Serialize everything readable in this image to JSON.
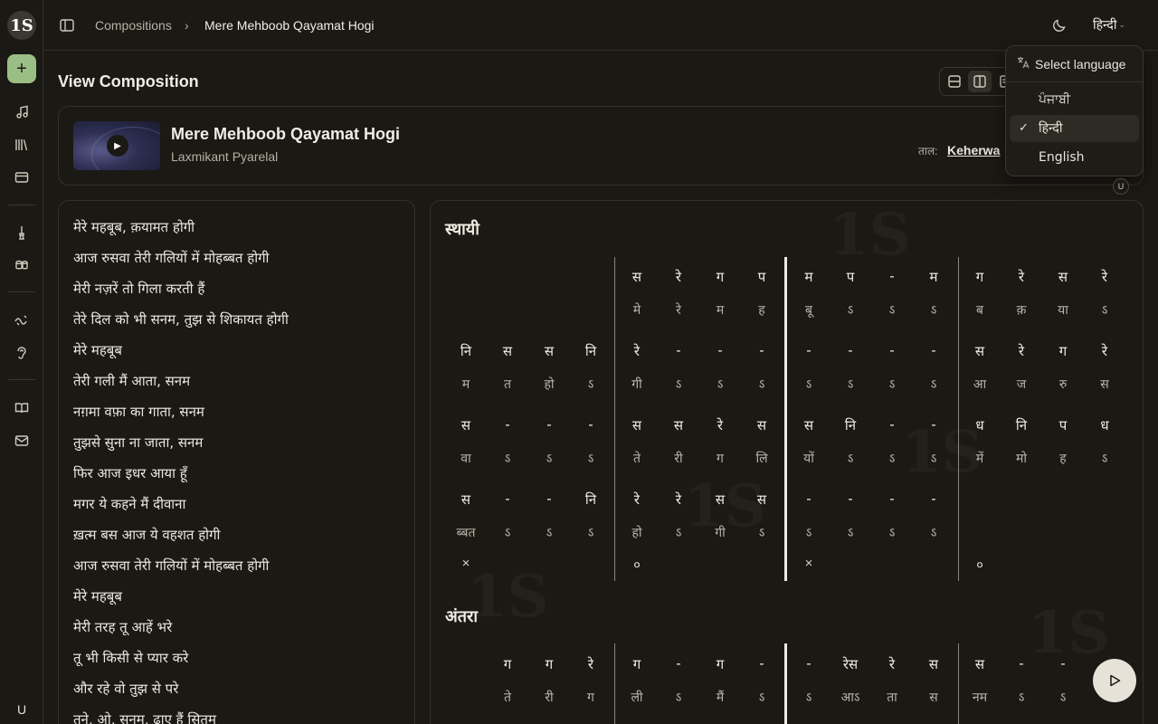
{
  "app": {
    "logo_text": "1S",
    "new_label": "+",
    "user_initial": "U"
  },
  "breadcrumb": {
    "root": "Compositions",
    "separator": "›",
    "current": "Mere Mehboob Qayamat Hogi"
  },
  "topbar": {
    "language_current": "हिन्दी",
    "language_chevron": "⌄"
  },
  "page": {
    "title": "View Composition"
  },
  "track": {
    "title": "Mere Mehboob Qayamat Hogi",
    "artist": "Laxmikant Pyarelal",
    "taal_label": "ताल:",
    "taal_value": "Keherwa",
    "play_glyph": "▶"
  },
  "lyrics": [
    "मेरे महबूब, क़यामत होगी",
    "आज रुसवा तेरी गलियों में मोहब्बत होगी",
    "मेरी नज़रें तो गिला करती हैं",
    "तेरे दिल को भी सनम, तुझ से शिकायत होगी",
    "मेरे महबूब",
    "तेरी गली मैं आता, सनम",
    "नग़मा वफ़ा का गाता, सनम",
    "तुझसे सुना ना जाता, सनम",
    "फिर आज इधर आया हूँ",
    "मगर ये कहने मैं दीवाना",
    "ख़त्म बस आज ये वहशत होगी",
    "आज रुसवा तेरी गलियों में मोहब्बत होगी",
    "मेरे महबूब",
    "मेरी तरह तू आहें भरे",
    "तू भी किसी से प्यार करे",
    "और रहे वो तुझ से परे",
    "तूने, ओ, सनम, ढाए हैं सितम"
  ],
  "notation": {
    "sthayi_title": "स्थायी",
    "antara_title": "अंतरा",
    "sthayi_rows": [
      {
        "swara": [
          "",
          "",
          "",
          "",
          "स",
          "रे",
          "ग",
          "प",
          "म",
          "प",
          "-",
          "म",
          "ग",
          "रे",
          "स",
          "रे"
        ],
        "bol": [
          "",
          "",
          "",
          "",
          "मे",
          "रे",
          "म",
          "ह",
          "बू",
          "ऽ",
          "ऽ",
          "ऽ",
          "ब",
          "क़",
          "या",
          "ऽ"
        ]
      },
      {
        "swara": [
          "नि",
          "स",
          "स",
          "नि",
          "रे",
          "-",
          "-",
          "-",
          "-",
          "-",
          "-",
          "-",
          "स",
          "रे",
          "ग",
          "रे"
        ],
        "bol": [
          "म",
          "त",
          "हो",
          "ऽ",
          "गी",
          "ऽ",
          "ऽ",
          "ऽ",
          "ऽ",
          "ऽ",
          "ऽ",
          "ऽ",
          "आ",
          "ज",
          "रु",
          "स"
        ]
      },
      {
        "swara": [
          "स",
          "-",
          "-",
          "-",
          "स",
          "स",
          "रे",
          "स",
          "स",
          "नि",
          "-",
          "-",
          "ध",
          "नि",
          "प",
          "ध"
        ],
        "bol": [
          "वा",
          "ऽ",
          "ऽ",
          "ऽ",
          "ते",
          "री",
          "ग",
          "लि",
          "यों",
          "ऽ",
          "ऽ",
          "ऽ",
          "में",
          "मो",
          "ह",
          "ऽ"
        ]
      },
      {
        "swara": [
          "स",
          "-",
          "-",
          "नि",
          "रे",
          "रे",
          "स",
          "स",
          "-",
          "-",
          "-",
          "-",
          "",
          "",
          "",
          ""
        ],
        "bol": [
          "ब्बत",
          "ऽ",
          "ऽ",
          "ऽ",
          "हो",
          "ऽ",
          "गी",
          "ऽ",
          "ऽ",
          "ऽ",
          "ऽ",
          "ऽ",
          "",
          "",
          "",
          ""
        ]
      }
    ],
    "taali_marks": [
      "×",
      "०",
      "×",
      "०"
    ],
    "antara_rows": [
      {
        "swara": [
          "",
          "ग",
          "ग",
          "रे",
          "ग",
          "-",
          "ग",
          "-",
          "-",
          "रेस",
          "रे",
          "स",
          "स",
          "-",
          "-",
          ""
        ],
        "bol": [
          "",
          "ते",
          "री",
          "ग",
          "ली",
          "ऽ",
          "मैं",
          "ऽ",
          "ऽ",
          "आऽ",
          "ता",
          "स",
          "नम",
          "ऽ",
          "ऽ",
          ""
        ]
      }
    ]
  },
  "language_menu": {
    "header": "Select language",
    "options": [
      "ਪੰਜਾਬੀ",
      "हिन्दी",
      "English"
    ],
    "selected": "हिन्दी",
    "check_glyph": "✓"
  },
  "badge": {
    "user_initial": "U"
  },
  "icons": {
    "play": "play-icon",
    "moon": "moon-icon",
    "sidebar": "sidebar-toggle-icon",
    "translate": "translate-icon"
  },
  "colors": {
    "background": "#1b1914",
    "accent_green": "#9bbd86",
    "text": "#f1ede4",
    "muted": "#b6b1a4"
  }
}
